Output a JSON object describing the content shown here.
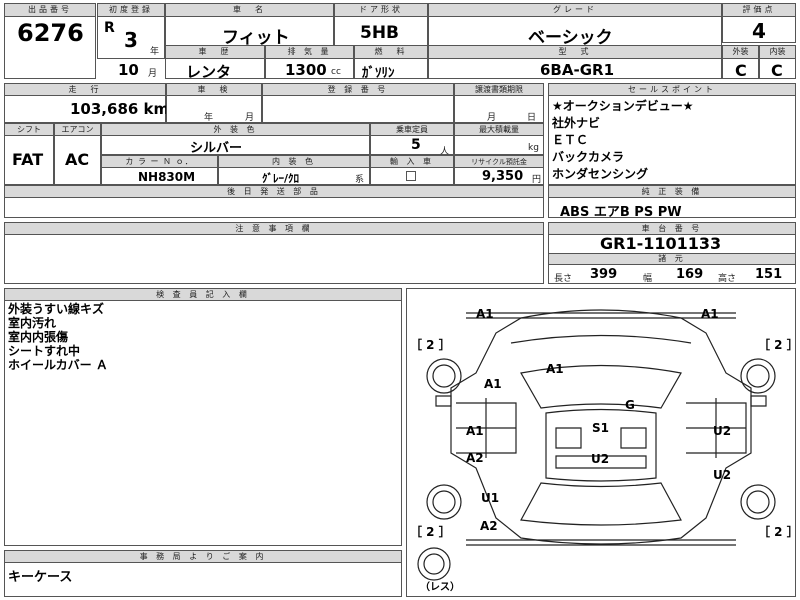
{
  "header": {
    "lot_no_label": "出品番号",
    "lot_no": "6276",
    "first_reg_label": "初度登録",
    "era": "R",
    "year_value": "3",
    "year_unit": "年",
    "month_value": "10",
    "month_unit": "月",
    "car_name_label": "車　名",
    "car_name": "フィット",
    "door_label": "ドア形状",
    "door": "5HB",
    "grade_label": "グレード",
    "grade": "ベーシック",
    "score_label": "評価点",
    "score": "4",
    "history_label": "車　歴",
    "history": "レンタ",
    "displacement_label": "排 気 量",
    "displacement": "1300",
    "displacement_unit": "cc",
    "fuel_label": "燃　料",
    "fuel": "ｶﾞｿﾘﾝ",
    "model_label": "型　式",
    "model": "6BA-GR1",
    "ext_label": "外装",
    "ext_score": "C",
    "int_label": "内装",
    "int_score": "C"
  },
  "row2": {
    "mileage_label": "走　行",
    "mileage": "103,686 km",
    "inspection_label": "車　検",
    "insp_year_unit": "年",
    "insp_month_unit": "月",
    "reg_no_label": "登 録 番 号",
    "transfer_label": "譲渡書類期限",
    "transfer_month_unit": "月",
    "transfer_day_unit": "日"
  },
  "row3": {
    "shift_label": "シフト",
    "shift": "FAT",
    "ac_label": "エアコン",
    "ac": "AC",
    "ext_color_label": "外 装 色",
    "ext_color": "シルバー",
    "capacity_label": "乗車定員",
    "capacity": "5",
    "capacity_unit": "人",
    "max_load_label": "最大積載量",
    "max_load_unit": "kg",
    "color_no_label": "カ ラ ー Ｎ ｏ．",
    "color_no": "NH830M",
    "int_color_label": "内 装 色",
    "int_color": "ｸﾞﾚｰ/ｸﾛ",
    "int_color_unit": "系",
    "import_label": "輸 入 車",
    "recycle_label": "リサイクル預託金",
    "recycle": "9,350",
    "recycle_unit": "円"
  },
  "after_parts_label": "後 日 発 送 部 品",
  "notes_label": "注 意 事 項 欄",
  "sales": {
    "label": "セールスポイント",
    "items": [
      "★オークションデビュー★",
      "社外ナビ",
      "ＥＴＣ",
      "バックカメラ",
      "ホンダセンシング"
    ]
  },
  "equipment": {
    "label": "純 正 装 備",
    "value": "ABS エアB PS PW"
  },
  "chassis": {
    "label": "車 台 番 号",
    "value": "GR1-1101133",
    "dims_label": "諸 元",
    "length_label": "長さ",
    "length": "399",
    "width_label": "幅",
    "width": "169",
    "height_label": "高さ",
    "height": "151"
  },
  "inspector": {
    "label": "検 査 員 記 入 欄",
    "items": [
      "外装うすい線キズ",
      "室内汚れ",
      "室内内張傷",
      "シートすれ中",
      "ホイールカバー Ａ"
    ]
  },
  "office": {
    "label": "事 務 局 よ り ご 案 内",
    "value": "キーケース"
  },
  "diagram": {
    "tire_fl": "［ 2 ］",
    "tire_fr": "［ 2 ］",
    "tire_rl": "［ 2 ］",
    "tire_rr": "［ 2 ］",
    "spare": "（レス）",
    "m_a1_tl": "A1",
    "m_a1_tr": "A1",
    "m_a1_hood": "A1",
    "m_a1_lfender": "A1",
    "m_g": "G",
    "m_a1_ldoor": "A1",
    "m_s1": "S1",
    "m_u2_rdoor": "U2",
    "m_a2_lrdoor": "A2",
    "m_u2_roof": "U2",
    "m_u2_rrdoor": "U2",
    "m_u1": "U1",
    "m_a2_rear": "A2"
  }
}
